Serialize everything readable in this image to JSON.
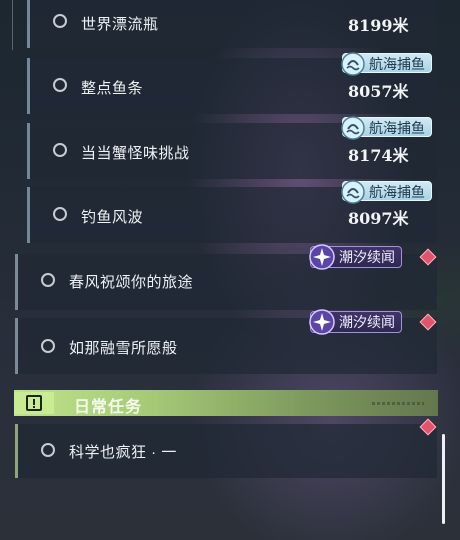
{
  "quests": [
    {
      "title": "世界漂流瓶",
      "distance": "8199米",
      "tag": ""
    },
    {
      "title": "整点鱼条",
      "distance": "8057米",
      "tag": "航海捕鱼"
    },
    {
      "title": "当当蟹怪味挑战",
      "distance": "8174米",
      "tag": "航海捕鱼"
    },
    {
      "title": "钓鱼风波",
      "distance": "8097米",
      "tag": "航海捕鱼"
    },
    {
      "title": "春风祝颂你的旅途",
      "distance": "",
      "tag": "潮汐续闻"
    },
    {
      "title": "如那融雪所愿般",
      "distance": "",
      "tag": "潮汐续闻"
    }
  ],
  "daily_section": {
    "title": "日常任务",
    "icon": "exclamation-box-icon",
    "items": [
      {
        "title": "科学也疯狂 · 一"
      }
    ]
  },
  "colors": {
    "sail_badge": "#a9d3e6",
    "tide_badge": "#2e2950",
    "tide_border": "#a78ee0",
    "daily_accent": "#bfe38a",
    "new_marker": "#e0546c"
  }
}
